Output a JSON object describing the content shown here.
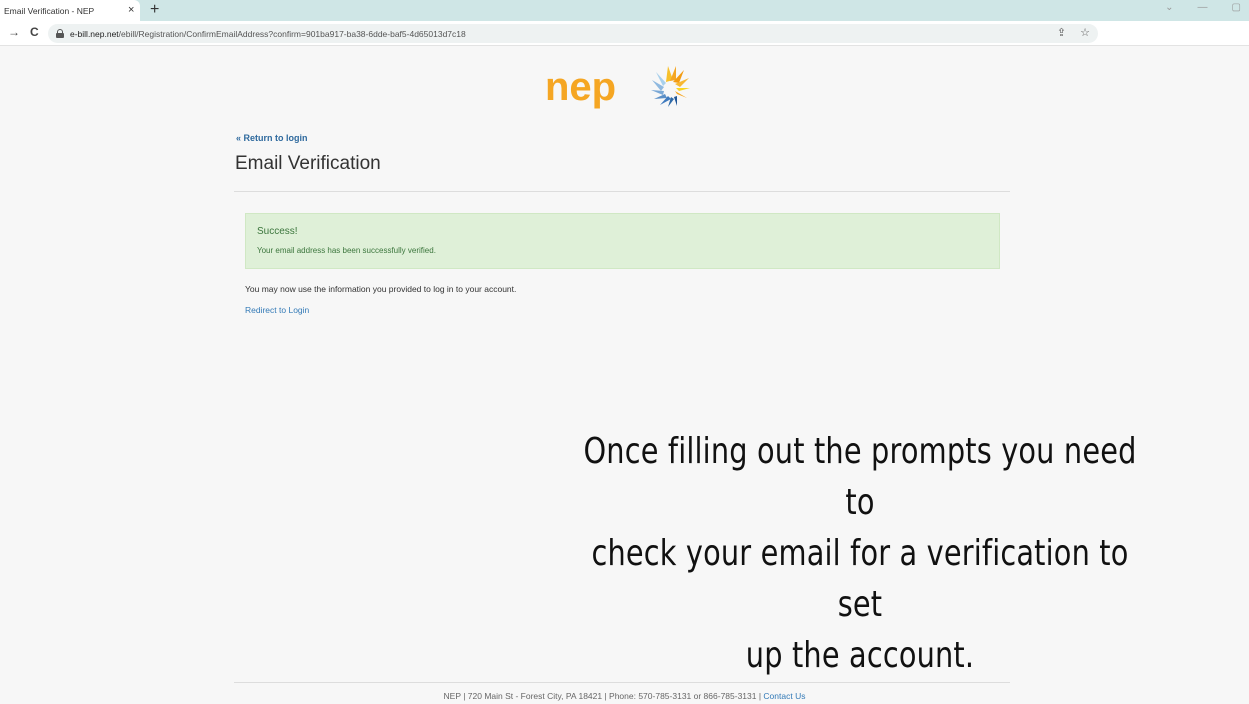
{
  "browser": {
    "tab_title": "Email Verification - NEP",
    "tab_close": "×",
    "new_tab": "+",
    "url_host": "e-bill.nep.net",
    "url_path": "/ebill/Registration/ConfirmEmailAddress?confirm=901ba917-ba38-6dde-baf5-4d65013d7c18",
    "back": "→",
    "reload": "C",
    "share_icon": "⇪",
    "star_icon": "☆",
    "min": "—",
    "max": "▢",
    "chevron": "⌄"
  },
  "page": {
    "logo_text": "nep",
    "return_link": "« Return to login",
    "title": "Email Verification",
    "alert_title": "Success!",
    "alert_message": "Your email address has been successfully verified.",
    "info_text": "You may now use the information you provided to log in to your account.",
    "redirect_link": "Redirect to Login"
  },
  "overlay_text": {
    "line1": "Once filling out the prompts you need to",
    "line2": "check your email for a verification to set",
    "line3": "up the account."
  },
  "footer": {
    "text": "NEP | 720 Main St - Forest City, PA 18421 | Phone: 570-785-3131 or 866-785-3131 | ",
    "contact_link": "Contact Us"
  },
  "colors": {
    "logo_orange": "#f5a623",
    "link_blue": "#337ab7",
    "success_bg": "#dff0d8",
    "success_text": "#3c763d"
  }
}
